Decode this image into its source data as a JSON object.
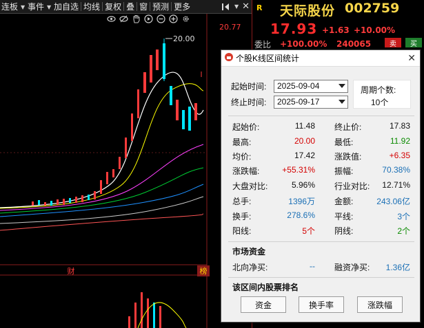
{
  "toolbar": {
    "items": [
      "连板",
      "事件",
      "加自选",
      "均线",
      "复权",
      "叠",
      "窗",
      "预测",
      "更多"
    ],
    "close_glyph": "✕"
  },
  "quote": {
    "badge": "R",
    "name": "天际股份",
    "code": "002759",
    "price": "17.93",
    "change": "+1.63",
    "change_pct": "+10.00%",
    "ratio_label": "委比",
    "ratio_value": "+100.00%",
    "ratio_volume": "240065",
    "sell_label": "卖",
    "buy_label": "买"
  },
  "chart": {
    "top_price_label": "20.77",
    "peak_label": "20.00",
    "marker_cai": "财",
    "marker_bang": "榜",
    "icons": [
      "eye-icon",
      "eye-hidden-icon",
      "hand-icon",
      "play-icon",
      "minus-circle-icon",
      "plus-circle-icon",
      "gear-icon"
    ]
  },
  "dialog": {
    "title": "个股K线区间统计",
    "close_glyph": "✕",
    "start_label": "起始时间:",
    "start_value": "2025-09-04",
    "end_label": "终止时间:",
    "end_value": "2025-09-17",
    "period_label": "周期个数:",
    "period_value": "10个",
    "stats": [
      {
        "l1": "起始价:",
        "v1": "11.48",
        "c1": "black",
        "l2": "终止价:",
        "v2": "17.83",
        "c2": "black"
      },
      {
        "l1": "最高:",
        "v1": "20.00",
        "c1": "red",
        "l2": "最低:",
        "v2": "11.92",
        "c2": "green"
      },
      {
        "l1": "均价:",
        "v1": "17.42",
        "c1": "black",
        "l2": "涨跌值:",
        "v2": "+6.35",
        "c2": "red"
      },
      {
        "l1": "涨跌幅:",
        "v1": "+55.31%",
        "c1": "red",
        "l2": "振幅:",
        "v2": "70.38%",
        "c2": "blue"
      },
      {
        "l1": "大盘对比:",
        "v1": "5.96%",
        "c1": "black",
        "l2": "行业对比:",
        "v2": "12.71%",
        "c2": "black"
      },
      {
        "l1": "总手:",
        "v1": "1396万",
        "c1": "blue",
        "l2": "金额:",
        "v2": "243.06亿",
        "c2": "blue"
      },
      {
        "l1": "换手:",
        "v1": "278.6%",
        "c1": "blue",
        "l2": "平线:",
        "v2": "3个",
        "c2": "blue"
      },
      {
        "l1": "阳线:",
        "v1": "5个",
        "c1": "red",
        "l2": "阴线:",
        "v2": "2个",
        "c2": "green"
      }
    ],
    "market_funds_title": "市场资金",
    "north_label": "北向净买:",
    "north_value": "--",
    "margin_label": "融资净买:",
    "margin_value": "1.36亿",
    "ranking_title": "该区间内股票排名",
    "btn_funds": "资金",
    "btn_turnover": "换手率",
    "btn_change": "涨跌幅"
  },
  "colors": {
    "up": "#ff3b3b",
    "down": "#00e5ff",
    "ma5": "#ffffff",
    "ma10": "#ffff00",
    "ma20": "#ff40ff",
    "ma30": "#00cc33",
    "ma60": "#1e90ff",
    "ma120": "#cccccc",
    "ma250": "#ff5555"
  }
}
